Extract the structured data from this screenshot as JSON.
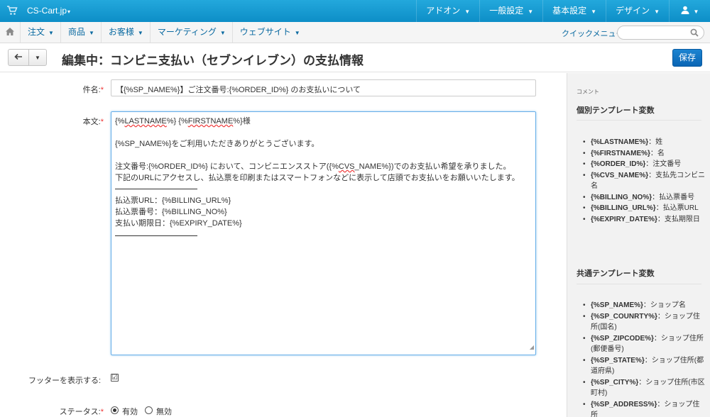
{
  "topbar": {
    "store_name": "CS-Cart.jp",
    "store_caret": "▾",
    "menu": [
      {
        "label": "アドオン"
      },
      {
        "label": "一般設定"
      },
      {
        "label": "基本設定"
      },
      {
        "label": "デザイン"
      }
    ]
  },
  "nav": {
    "items": [
      {
        "label": "注文"
      },
      {
        "label": "商品"
      },
      {
        "label": "お客様"
      },
      {
        "label": "マーケティング"
      },
      {
        "label": "ウェブサイト"
      }
    ],
    "quick_menu": "クイックメニュー",
    "search_placeholder": ""
  },
  "header": {
    "title": "編集中：コンビニ支払い（セブンイレブン）の支払情報",
    "save_label": "保存"
  },
  "form": {
    "subject_label": "件名:",
    "subject_value": "【{%SP_NAME%}】ご注文番号:{%ORDER_ID%} のお支払いについて",
    "body_label": "本文:",
    "body": {
      "l1a": "{%",
      "l1b": "LASTNAME",
      "l1c": "%} {%",
      "l1d": "FIRSTNAME",
      "l1e": "%}様",
      "l2": "{%SP_NAME%}をご利用いただきありがとうございます。",
      "l3a": "注文番号:{%ORDER_ID%} において、コンビニエンスストア({%",
      "l3b": "CVS",
      "l3c": "_NAME%})でのお支払い希望を承りました。",
      "l4": "下記のURLにアクセスし、払込票を印刷またはスマートフォンなどに表示して店頭でお支払いをお願いいたします。",
      "l5": "払込票URL：{%BILLING_URL%}",
      "l6": "払込票番号：{%BILLING_NO%}",
      "l7": "支払い期限日：{%EXPIRY_DATE%}"
    },
    "footer_label": "フッターを表示する:",
    "footer_checked": "☑",
    "status_label": "ステータス:",
    "status_on": "有効",
    "status_off": "無効",
    "required_mark": "*"
  },
  "sidebar": {
    "small_title": "コメント",
    "section1_title": "個別テンプレート変数",
    "section1_items": [
      {
        "var": "{%LASTNAME%}",
        "desc": "：姓"
      },
      {
        "var": "{%FIRSTNAME%}",
        "desc": "：名"
      },
      {
        "var": "{%ORDER_ID%}",
        "desc": "：注文番号"
      },
      {
        "var": "{%CVS_NAME%}",
        "desc": "：支払先コンビニ名"
      },
      {
        "var": "{%BILLING_NO%}",
        "desc": "：払込票番号"
      },
      {
        "var": "{%BILLING_URL%}",
        "desc": "：払込票URL"
      },
      {
        "var": "{%EXPIRY_DATE%}",
        "desc": "：支払期限日"
      }
    ],
    "section2_title": "共通テンプレート変数",
    "section2_items": [
      {
        "var": "{%SP_NAME%}",
        "desc": "：ショップ名"
      },
      {
        "var": "{%SP_COUNRTY%}",
        "desc": "：ショップ住所(国名)"
      },
      {
        "var": "{%SP_ZIPCODE%}",
        "desc": "：ショップ住所(郵便番号)"
      },
      {
        "var": "{%SP_STATE%}",
        "desc": "：ショップ住所(都道府県)"
      },
      {
        "var": "{%SP_CITY%}",
        "desc": "：ショップ住所(市区町村)"
      },
      {
        "var": "{%SP_ADDRESS%}",
        "desc": "：ショップ住所"
      }
    ]
  },
  "colors": {
    "topbar": "#1a9fd6",
    "link": "#0a6aa1",
    "save_button": "#1275c4"
  }
}
